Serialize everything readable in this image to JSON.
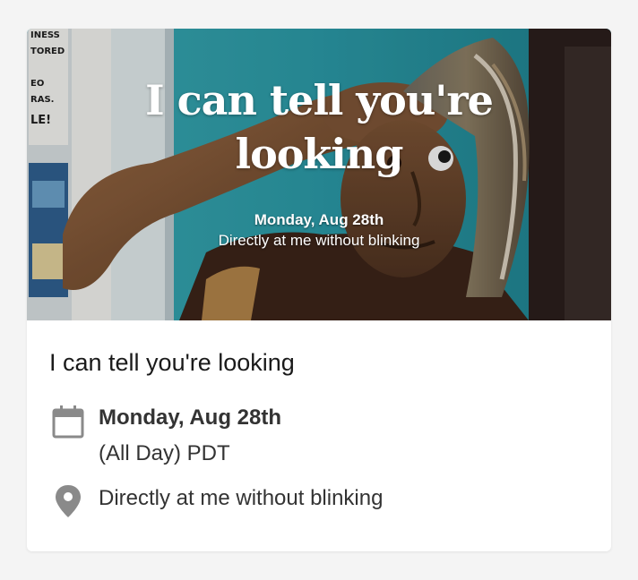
{
  "banner": {
    "title_line1": "I can tell you're",
    "title_line2": "looking",
    "date": "Monday, Aug 28th",
    "location": "Directly at me without blinking"
  },
  "event": {
    "title": "I can tell you're looking",
    "date": "Monday, Aug 28th",
    "time": "(All Day) PDT",
    "location": "Directly at me without blinking"
  },
  "poster_text": [
    "INESS",
    "TORED",
    "EO",
    "RAS.",
    "LE!"
  ],
  "colors": {
    "background": "#f4f4f4",
    "card": "#ffffff",
    "icon": "#8a8a8a",
    "text": "#333333",
    "title_text": "#1a1a1a"
  },
  "icons": {
    "date": "calendar-icon",
    "location": "map-pin-icon"
  }
}
